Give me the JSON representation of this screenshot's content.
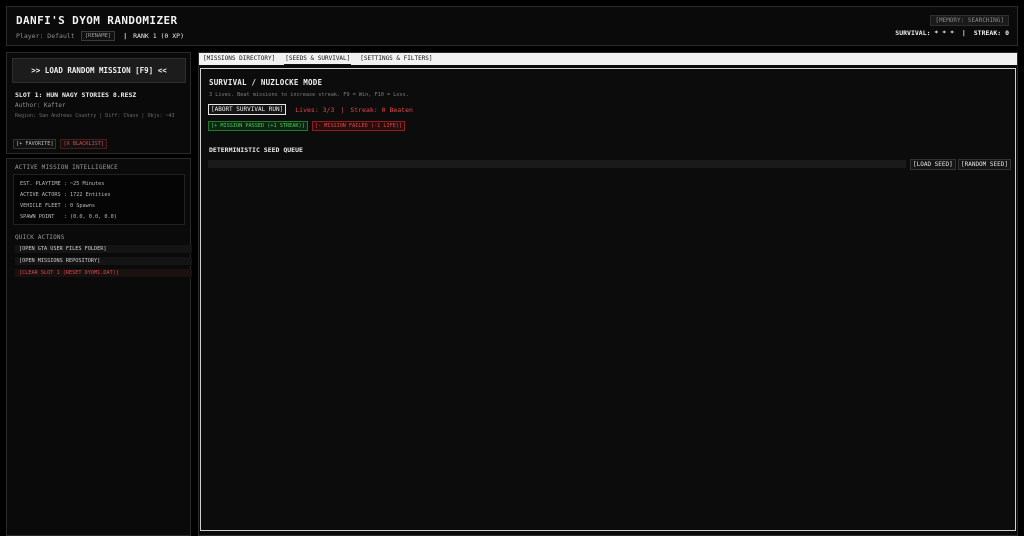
{
  "header": {
    "title": "DANFI'S DYOM RANDOMIZER",
    "player_label": "Player: Default",
    "rename_label": "[RENAME]",
    "separator": "|",
    "rank_label": "RANK 1  (0 XP)",
    "memory_badge": "[MEMORY: SEARCHING]",
    "survival_label": "SURVIVAL: * * *",
    "status_separator": "|",
    "streak_label": "STREAK: 0"
  },
  "mission_panel": {
    "load_button": ">> LOAD RANDOM MISSION [F9] <<",
    "slot_title": "SLOT 1: HUN NAGY STORIES 8.RESZ",
    "author": "Author: Kafter",
    "meta": "Region: San Andreas Country | Diff: Chaos | Objs: ~43",
    "favorite_label": "[+ FAVORITE]",
    "blacklist_label": "[X BLACKLIST]"
  },
  "intel": {
    "heading": "ACTIVE MISSION INTELLIGENCE",
    "lines": [
      "EST. PLAYTIME : ~25 Minutes",
      "ACTIVE ACTORS : 1722 Entities",
      "VEHICLE FLEET : 0 Spawns",
      "SPAWN POINT   : (0.0, 0.0, 0.0)"
    ]
  },
  "quick_actions": {
    "heading": "QUICK ACTIONS",
    "items": [
      "[OPEN GTA USER FILES FOLDER]",
      "[OPEN MISSIONS REPOSITORY]",
      "[CLEAR SLOT 1 (RESET DYOM1.DAT)]"
    ]
  },
  "tabs": [
    {
      "label": "[MISSIONS DIRECTORY]"
    },
    {
      "label": "[SEEDS & SURVIVAL]"
    },
    {
      "label": "[SETTINGS & FILTERS]"
    }
  ],
  "survival": {
    "title": "SURVIVAL / NUZLOCKE MODE",
    "description": "3 Lives. Beat missions to increase streak. F9 = Win, F10 = Loss.",
    "abort_label": "[ABORT SURVIVAL RUN]",
    "lives_label": "Lives: 3/3",
    "separator": "|",
    "streak_label": "Streak: 0 Beaten",
    "pass_label": "[+ MISSION PASSED (+1 STREAK)]",
    "fail_label": "[- MISSION FAILED (-1 LIFE)]"
  },
  "seeds": {
    "title": "DETERMINISTIC SEED QUEUE",
    "load_label": "[LOAD SEED]",
    "random_label": "[RANDOM SEED]"
  },
  "colors": {
    "background": "#000000",
    "panel": "#0a0a0a",
    "danger": "#e04a4a",
    "success": "#43d15b",
    "text": "#f0f0f0"
  }
}
